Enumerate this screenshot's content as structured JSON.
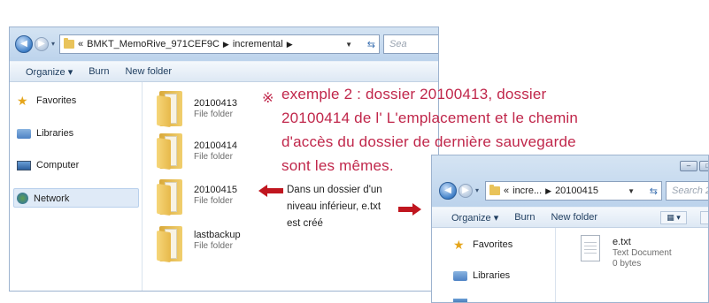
{
  "window1": {
    "breadcrumb": {
      "prefix": "«",
      "folder1": "BMKT_MemoRive_971CEF9C",
      "folder2": "incremental"
    },
    "search_placeholder": "Sea",
    "toolbar": {
      "organize": "Organize ▾",
      "burn": "Burn",
      "new_folder": "New folder"
    },
    "nav": {
      "favorites": "Favorites",
      "libraries": "Libraries",
      "computer": "Computer",
      "network": "Network"
    },
    "files": [
      {
        "name": "20100413",
        "type": "File folder"
      },
      {
        "name": "20100414",
        "type": "File folder"
      },
      {
        "name": "20100415",
        "type": "File folder"
      },
      {
        "name": "lastbackup",
        "type": "File folder"
      }
    ]
  },
  "annotation": {
    "mark": "※",
    "line1": "exemple 2 : dossier 20100413, dossier",
    "line2": "20100414 de l' L'emplacement et le chemin",
    "line3": "d'accès du dossier de dernière sauvegarde",
    "line4": "sont les mêmes.",
    "explain1": "Dans un dossier d'un",
    "explain2": "niveau inférieur, e.txt",
    "explain3": "est créé"
  },
  "window2": {
    "breadcrumb": {
      "prefix": "«",
      "folder1": "incre...",
      "folder2": "20100415"
    },
    "search_placeholder": "Search 20...",
    "toolbar": {
      "organize": "Organize ▾",
      "burn": "Burn",
      "new_folder": "New folder"
    },
    "nav": {
      "favorites": "Favorites",
      "libraries": "Libraries"
    },
    "file": {
      "name": "e.txt",
      "type": "Text Document",
      "size": "0 bytes"
    }
  },
  "colors": {
    "annotation": "#c0264a",
    "arrow": "#c0161f",
    "toolbar_text": "#1e3d5f"
  }
}
